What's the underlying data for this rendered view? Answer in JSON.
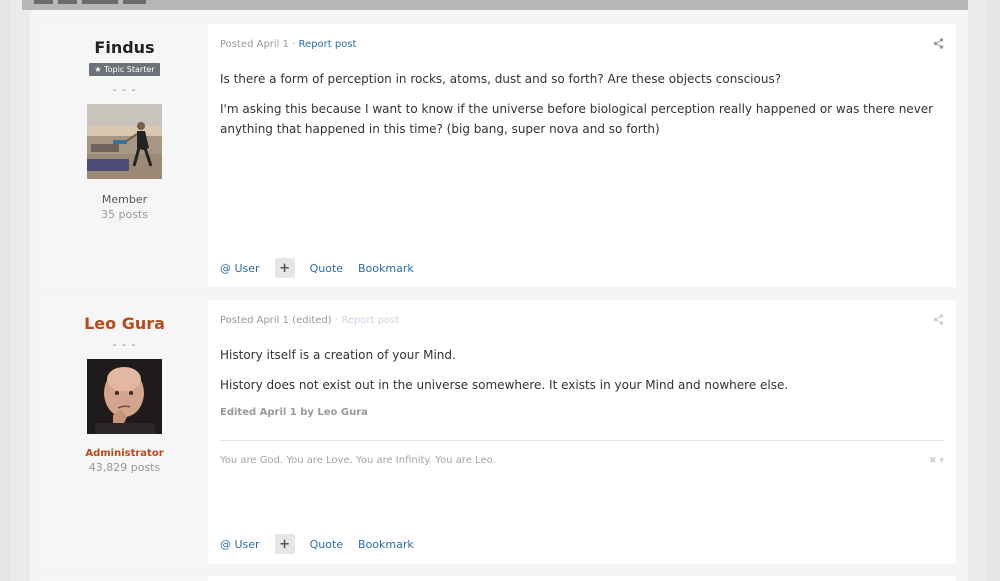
{
  "posts": [
    {
      "author": "Findus",
      "badge": "★ Topic Starter",
      "dashes": "- - -",
      "rank": "Member",
      "post_count": "35 posts",
      "posted": "Posted April 1",
      "sep": " · ",
      "report": "Report post",
      "share_icon": "share-icon",
      "paragraphs": [
        "Is there a form of perception in rocks, atoms, dust and so forth? Are these objects conscious?",
        "I'm asking this because I want to know if the universe before biological perception really happened or was there never anything that happened in this time? (big bang, super nova and so forth)"
      ],
      "actions": {
        "user": "@ User",
        "plus": "+",
        "quote": "Quote",
        "bookmark": "Bookmark"
      }
    },
    {
      "author": "Leo Gura",
      "dashes": "- - -",
      "rank": "Administrator",
      "post_count": "43,829 posts",
      "posted": "Posted April 1 (edited)",
      "sep": " · ",
      "report": "Report post",
      "share_icon": "share-icon",
      "paragraphs": [
        "History itself is a creation of your Mind.",
        "History does not exist out in the universe somewhere. It exists in your Mind and nowhere else."
      ],
      "edited": "Edited April 1 by Leo Gura",
      "signature": "You are God. You are Love. You are Infinity. You are Leo.",
      "signature_controls": "✖ ▾",
      "actions": {
        "user": "@ User",
        "plus": "+",
        "quote": "Quote",
        "bookmark": "Bookmark"
      }
    }
  ],
  "colors": {
    "admin": "#b84a1a",
    "link": "#2b6ea8",
    "badge_bg": "#6d7278"
  }
}
